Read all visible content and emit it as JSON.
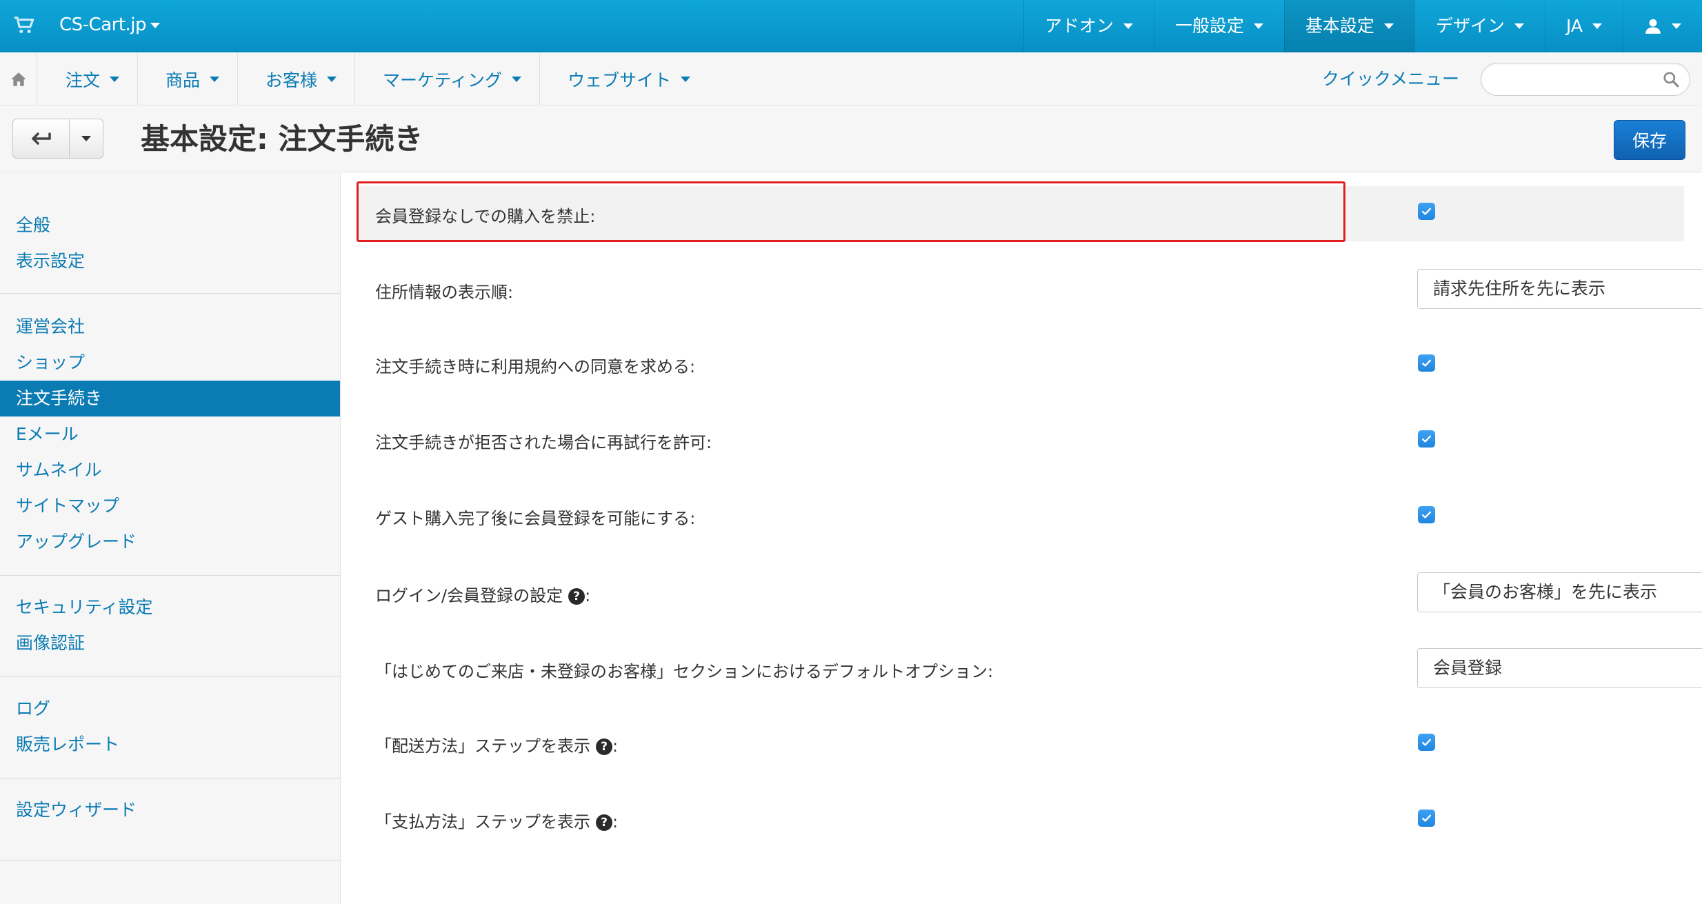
{
  "topbar": {
    "brand": "CS-Cart.jp",
    "menu": [
      {
        "label": "アドオン",
        "active": false
      },
      {
        "label": "一般設定",
        "active": false
      },
      {
        "label": "基本設定",
        "active": true
      },
      {
        "label": "デザイン",
        "active": false
      },
      {
        "label": "JA",
        "active": false
      }
    ]
  },
  "navbar": {
    "menu": [
      "注文",
      "商品",
      "お客様",
      "マーケティング",
      "ウェブサイト"
    ],
    "quick_menu": "クイックメニュー",
    "search_placeholder": ""
  },
  "titlebar": {
    "title": "基本設定: 注文手続き",
    "save_label": "保存"
  },
  "sidebar": {
    "groups": [
      [
        "全般",
        "表示設定"
      ],
      [
        "運営会社",
        "ショップ",
        "注文手続き",
        "Eメール",
        "サムネイル",
        "サイトマップ",
        "アップグレード"
      ],
      [
        "セキュリティ設定",
        "画像認証"
      ],
      [
        "ログ",
        "販売レポート"
      ],
      [
        "設定ウィザード"
      ]
    ],
    "active": "注文手続き"
  },
  "settings": [
    {
      "label": "会員登録なしでの購入を禁止:",
      "type": "checkbox",
      "checked": true
    },
    {
      "label": "住所情報の表示順:",
      "type": "select",
      "value": "請求先住所を先に表示"
    },
    {
      "label": "注文手続き時に利用規約への同意を求める:",
      "type": "checkbox",
      "checked": true
    },
    {
      "label": "注文手続きが拒否された場合に再試行を許可:",
      "type": "checkbox",
      "checked": true
    },
    {
      "label": "ゲスト購入完了後に会員登録を可能にする:",
      "type": "checkbox",
      "checked": true
    },
    {
      "label": "ログイン/会員登録の設定",
      "type": "select",
      "value": "「会員のお客様」を先に表示",
      "help": true
    },
    {
      "label": "「はじめてのご来店・未登録のお客様」セクションにおけるデフォルトオプション:",
      "type": "select",
      "value": "会員登録"
    },
    {
      "label": "「配送方法」ステップを表示",
      "type": "checkbox",
      "checked": true,
      "help": true
    },
    {
      "label": "「支払方法」ステップを表示",
      "type": "checkbox",
      "checked": true,
      "help": true
    }
  ],
  "colors": {
    "topbar": "#0a9bd0",
    "link": "#0b7bb3",
    "save_button": "#1570c4",
    "highlight_border": "#e02020",
    "checkbox": "#2b8fe6"
  }
}
